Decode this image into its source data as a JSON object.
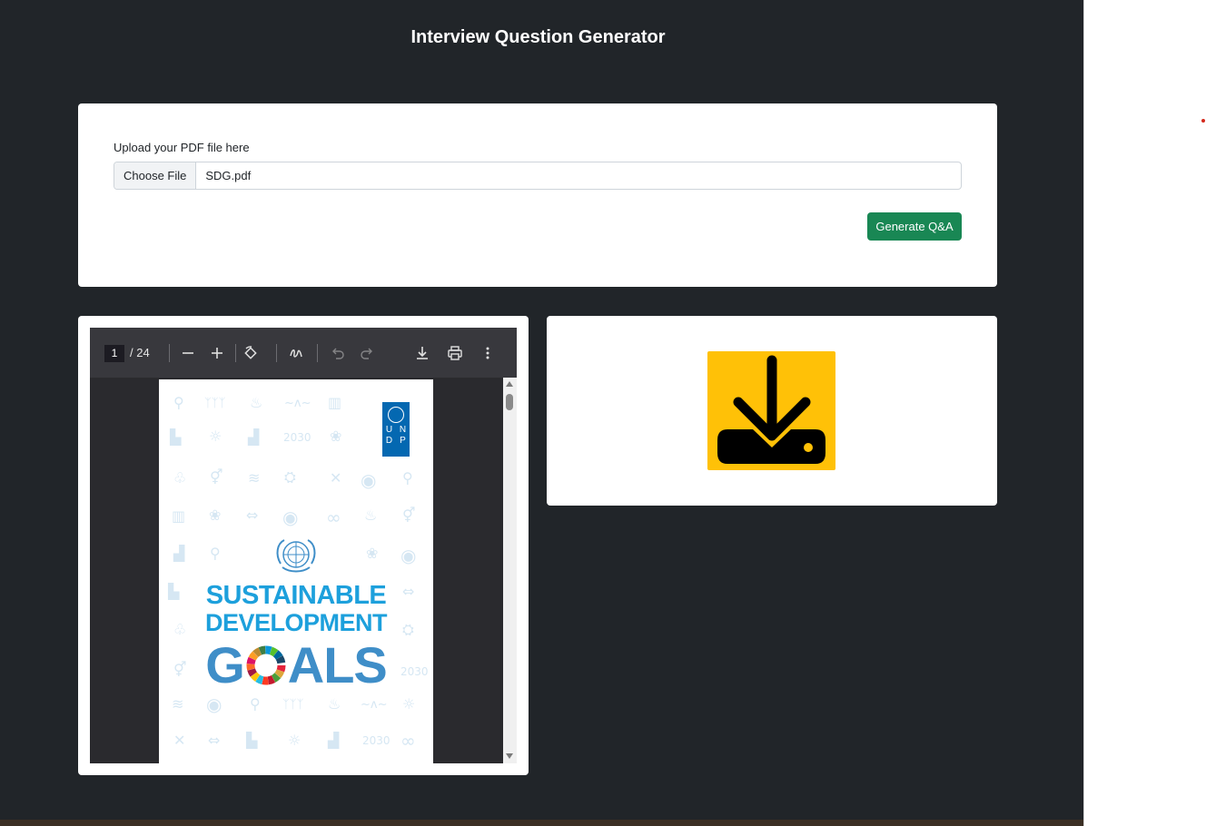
{
  "header": {
    "title": "Interview Question Generator"
  },
  "upload": {
    "label": "Upload your PDF file here",
    "choose_file_label": "Choose File",
    "file_name": "SDG.pdf",
    "generate_label": "Generate Q&A",
    "generate_color": "#198754"
  },
  "pdf_viewer": {
    "current_page": "1",
    "page_total": "/ 24",
    "toolbar_icons": [
      "zoom-out-icon",
      "zoom-in-icon",
      "rotate-icon",
      "draw-icon",
      "undo-icon",
      "redo-icon",
      "download-icon",
      "print-icon",
      "more-options-icon"
    ],
    "document": {
      "undp_letters": [
        "U",
        "N",
        "D",
        "P"
      ],
      "line1": "SUSTAINABLE",
      "line2": "DEVELOPMENT",
      "goals_g": "G",
      "goals_rest": "ALS",
      "year_mark": "2030"
    }
  },
  "download": {
    "icon": "download-tray-icon",
    "background_color": "#ffc107"
  }
}
